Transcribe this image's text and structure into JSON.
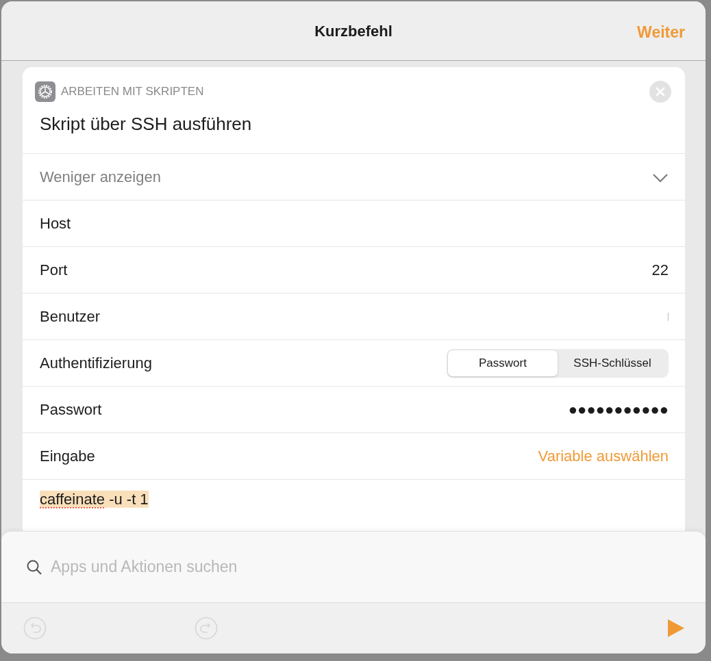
{
  "window": {
    "title": "Kurzbefehl",
    "next_button": "Weiter"
  },
  "action": {
    "category": "ARBEITEN MIT SKRIPTEN",
    "title": "Skript über SSH ausführen",
    "toggle": "Weniger anzeigen",
    "expanded": true,
    "rows": [
      {
        "kind": "text",
        "label": "Host",
        "focused": false
      },
      {
        "kind": "text",
        "label": "Port",
        "value": "22"
      },
      {
        "kind": "text",
        "label": "Benutzer",
        "focused": true
      },
      {
        "kind": "segmented",
        "label": "Authentifizierung",
        "options": [
          {
            "label": "Passwort",
            "selected": true
          },
          {
            "label": "SSH-Schlüssel",
            "selected": false
          }
        ]
      },
      {
        "kind": "text",
        "label": "Passwort",
        "value": "●●●●●●●●●●●"
      },
      {
        "kind": "link",
        "label": "Eingabe",
        "value": "Variable auswählen"
      }
    ],
    "script": {
      "highlighted": true,
      "tokens": [
        {
          "text": "caffeinate",
          "misspelled": true
        },
        {
          "text": "-u -t 1",
          "misspelled": false
        }
      ]
    }
  },
  "search": {
    "placeholder": "Apps und Aktionen suchen"
  },
  "toolbar": {
    "undo_disabled": true,
    "redo_disabled": true,
    "run_disabled": false
  }
}
